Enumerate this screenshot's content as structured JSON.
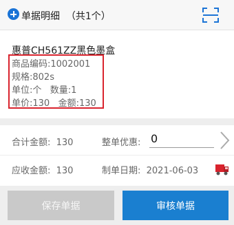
{
  "header": {
    "title": "单据明细  （共1个）",
    "add_icon": "plus-circle",
    "scan_icon": "scan-frame"
  },
  "item": {
    "name": "惠普CH561ZZ黑色墨盒",
    "code": "商品编码:1002001",
    "spec": "规格:802s",
    "unit_qty": "单位:个   数量:1",
    "price_amount": "单价:130   金额:130"
  },
  "summary": {
    "total_label": "合计金额:  130",
    "discount_label": "整单优惠:",
    "discount_value": "0",
    "receivable_label": "应收金额:  130",
    "date_label": "制单日期:  2021-06-03"
  },
  "buttons": {
    "save": "保存单据",
    "audit": "审核单据"
  },
  "colors": {
    "accent": "#1a7fd0",
    "highlight_border": "#d9232d",
    "disabled": "#c9c9c9"
  }
}
